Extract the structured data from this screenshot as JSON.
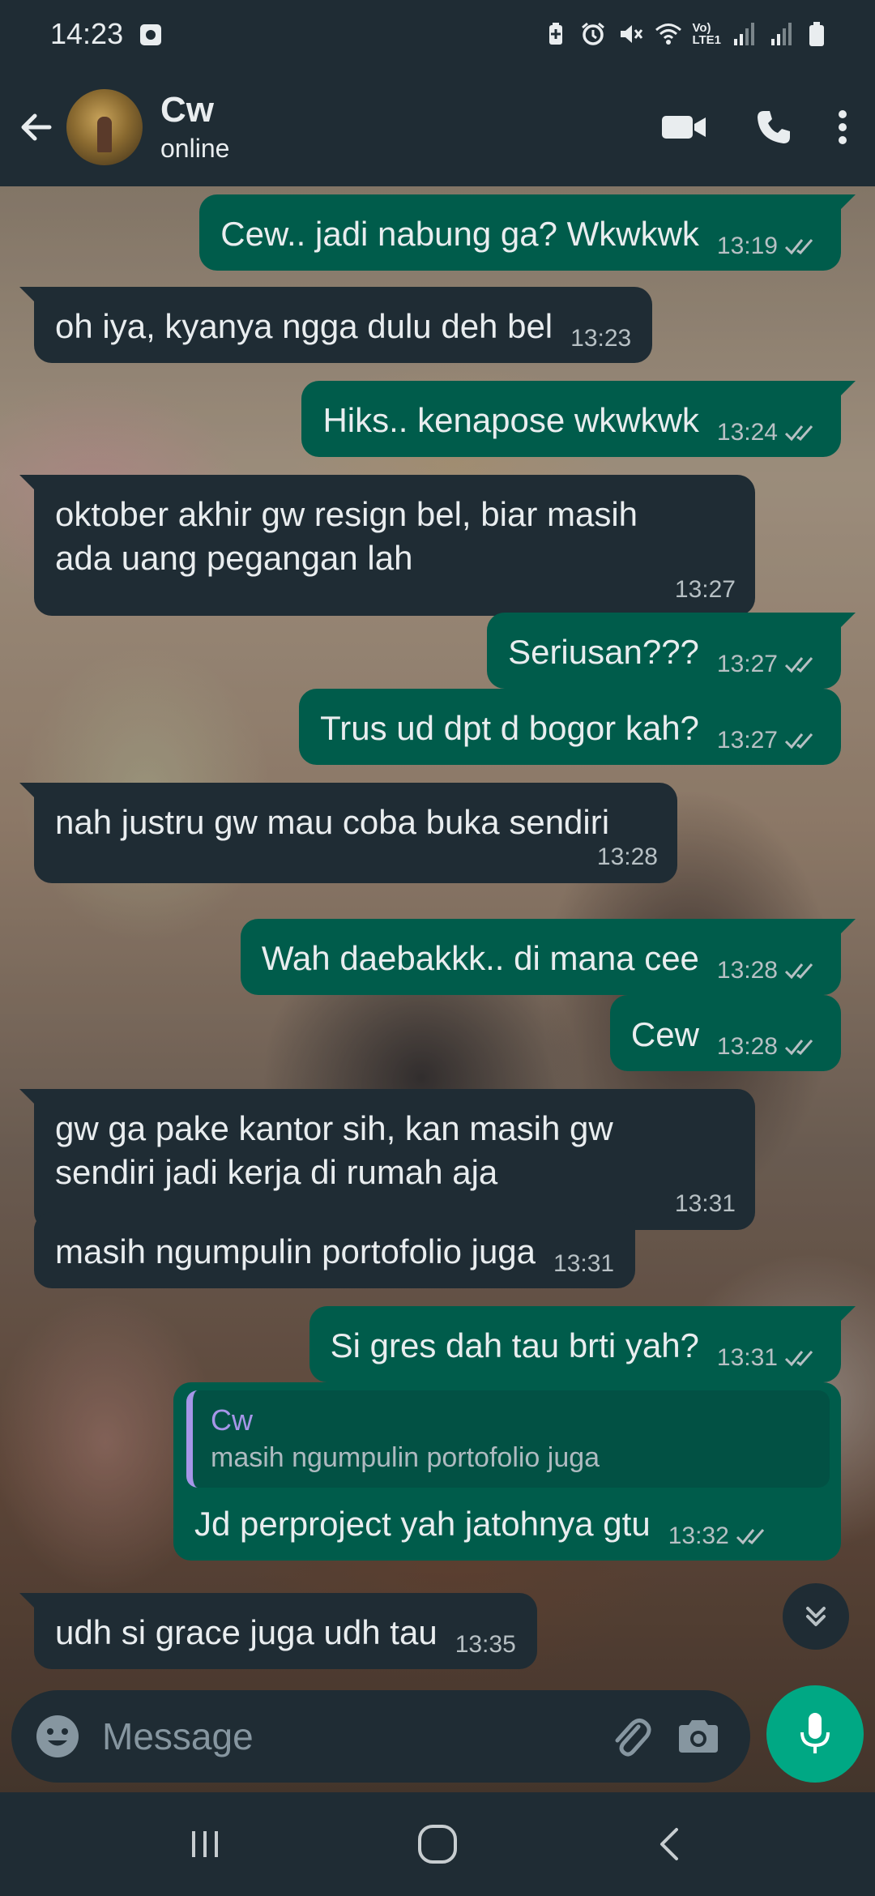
{
  "status_bar": {
    "time": "14:23",
    "network": "Vo)\nLTE1",
    "icons": [
      "photo-icon",
      "battery-saver-icon",
      "alarm-icon",
      "mute-icon",
      "wifi-icon",
      "signal-icon",
      "signal-icon",
      "battery-icon"
    ]
  },
  "header": {
    "contact_name": "Cw",
    "contact_status": "online",
    "icons": [
      "back-arrow-icon",
      "video-call-icon",
      "phone-call-icon",
      "more-vert-icon"
    ]
  },
  "messages": [
    {
      "dir": "out",
      "text": "Cew.. jadi nabung ga? Wkwkwk",
      "time": "13:19",
      "read": true
    },
    {
      "dir": "in",
      "text": "oh iya, kyanya ngga dulu deh bel",
      "time": "13:23"
    },
    {
      "dir": "out",
      "text": "Hiks.. kenapose wkwkwk",
      "time": "13:24",
      "read": true
    },
    {
      "dir": "in",
      "text": "oktober akhir gw resign bel, biar masih\nada uang pegangan lah",
      "time": "13:27"
    },
    {
      "dir": "out",
      "text": "Seriusan???",
      "time": "13:27",
      "read": true
    },
    {
      "dir": "out",
      "text": "Trus ud dpt d bogor kah?",
      "time": "13:27",
      "read": true
    },
    {
      "dir": "in",
      "text": "nah justru gw mau coba buka sendiri",
      "time": "13:28"
    },
    {
      "dir": "out",
      "text": "Wah daebakkk.. di mana cee",
      "time": "13:28",
      "read": true
    },
    {
      "dir": "out",
      "text": "Cew",
      "time": "13:28",
      "read": true
    },
    {
      "dir": "in",
      "text": "gw ga pake kantor sih, kan masih gw\nsendiri jadi kerja di rumah aja",
      "time": "13:31"
    },
    {
      "dir": "in",
      "text": "masih ngumpulin portofolio juga",
      "time": "13:31"
    },
    {
      "dir": "out",
      "text": "Si gres dah tau brti yah?",
      "time": "13:31",
      "read": true
    },
    {
      "dir": "out",
      "text": "Jd perproject yah jatohnya gtu",
      "time": "13:32",
      "read": true,
      "quote": {
        "author": "Cw",
        "text": "masih ngumpulin portofolio juga"
      }
    },
    {
      "dir": "in",
      "text": "udh si grace juga udh tau",
      "time": "13:35"
    }
  ],
  "composer": {
    "placeholder": "Message",
    "icons": [
      "emoji-icon",
      "attach-icon",
      "camera-icon",
      "mic-icon",
      "scroll-down-icon"
    ]
  },
  "nav": {
    "icons": [
      "recent-apps-icon",
      "home-icon",
      "back-icon"
    ]
  },
  "colors": {
    "outgoing_bubble": "#005c4b",
    "incoming_bubble": "#1f2c34",
    "accent": "#00a884",
    "quote_author": "#a696e8",
    "read_ticks": "#b7c0c4"
  }
}
